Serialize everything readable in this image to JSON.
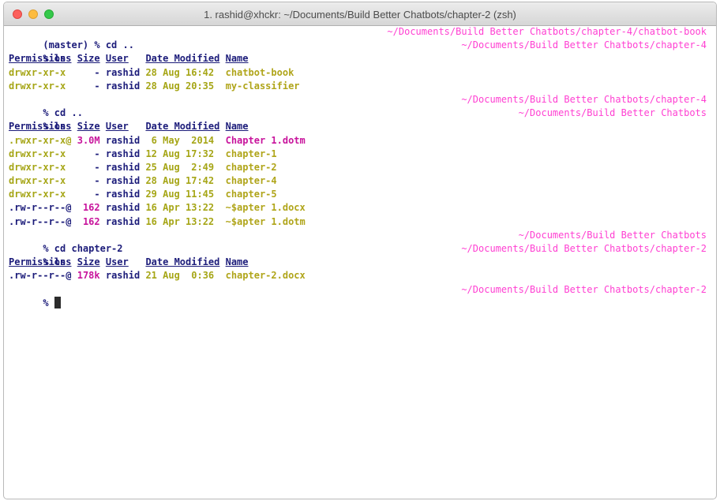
{
  "window": {
    "title": "1. rashid@xhckr: ~/Documents/Build Better Chatbots/chapter-2 (zsh)"
  },
  "colors": {
    "prompt": "#1c1c7a",
    "path": "#ff3fd2",
    "yellow": "#a6a617",
    "magenta": "#c8149c",
    "green": "#2b9a2b"
  },
  "terminal": {
    "l1_prompt": "(master) % cd ..",
    "l1_path": "~/Documents/Build Better Chatbots/chapter-4/chatbot-book",
    "l2_prompt": "% ls",
    "l2_path": "~/Documents/Build Better Chatbots/chapter-4",
    "h_perm": "Permissions",
    "h_size": "Size",
    "h_user": "User",
    "h_date": "Date Modified",
    "h_name": "Name",
    "r1_perm": "drwxr-xr-x",
    "r1_size": "-",
    "r1_user": "rashid",
    "r1_date": "28 Aug 16:42",
    "r1_name": "chatbot-book",
    "r2_perm": "drwxr-xr-x",
    "r2_size": "-",
    "r2_user": "rashid",
    "r2_date": "28 Aug 20:35",
    "r2_name": "my-classifier",
    "l3_prompt": "% cd ..",
    "l3_path": "~/Documents/Build Better Chatbots/chapter-4",
    "l4_prompt": "% ls",
    "l4_path": "~/Documents/Build Better Chatbots",
    "s1_perm": ".rwxr-xr-x@",
    "s1_size": "3.0M",
    "s1_user": "rashid",
    "s1_date": "6 May  2014",
    "s1_name": "Chapter 1.dotm",
    "s2_perm": "drwxr-xr-x",
    "s2_size": "-",
    "s2_user": "rashid",
    "s2_date": "12 Aug 17:32",
    "s2_name": "chapter-1",
    "s3_perm": "drwxr-xr-x",
    "s3_size": "-",
    "s3_user": "rashid",
    "s3_date": "25 Aug  2:49",
    "s3_name": "chapter-2",
    "s4_perm": "drwxr-xr-x",
    "s4_size": "-",
    "s4_user": "rashid",
    "s4_date": "28 Aug 17:42",
    "s4_name": "chapter-4",
    "s5_perm": "drwxr-xr-x",
    "s5_size": "-",
    "s5_user": "rashid",
    "s5_date": "29 Aug 11:45",
    "s5_name": "chapter-5",
    "s6_perm": ".rw-r--r--@",
    "s6_size": "162",
    "s6_user": "rashid",
    "s6_date": "16 Apr 13:22",
    "s6_name": "~$apter 1.docx",
    "s7_perm": ".rw-r--r--@",
    "s7_size": "162",
    "s7_user": "rashid",
    "s7_date": "16 Apr 13:22",
    "s7_name": "~$apter 1.dotm",
    "l5_prompt": "% cd chapter-2",
    "l5_path": "~/Documents/Build Better Chatbots",
    "l6_prompt": "% ls",
    "l6_path": "~/Documents/Build Better Chatbots/chapter-2",
    "t1_perm": ".rw-r--r--@",
    "t1_size": "178k",
    "t1_user": "rashid",
    "t1_date": "21 Aug  0:36",
    "t1_name": "chapter-2.docx",
    "l7_prompt": "%",
    "l7_path": "~/Documents/Build Better Chatbots/chapter-2"
  }
}
